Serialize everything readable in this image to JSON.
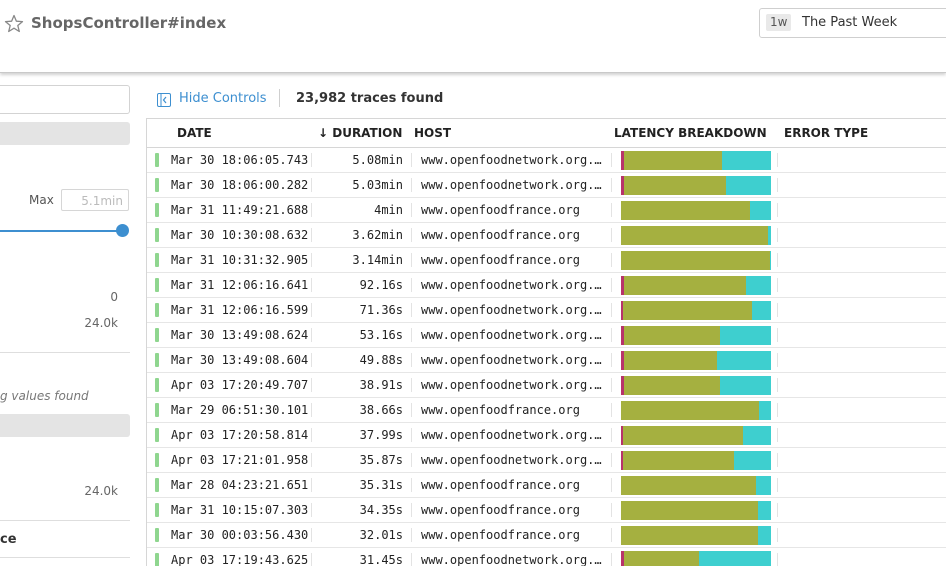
{
  "header": {
    "title": "ShopsController#index",
    "time_badge": "1w",
    "time_label": "The Past Week"
  },
  "left_panel": {
    "max_label": "Max",
    "max_placeholder": "5.1min",
    "count_0": "0",
    "count_1": "24.0k",
    "missing_text": "g values found",
    "count_2": "24.0k",
    "section_label": "ce"
  },
  "controls": {
    "hide_controls_label": "Hide Controls",
    "trace_count": "23,982 traces found"
  },
  "table": {
    "columns": {
      "date": "DATE",
      "duration": "↓ DURATION",
      "host": "HOST",
      "latency": "LATENCY BREAKDOWN",
      "error": "ERROR TYPE"
    },
    "rows": [
      {
        "date": "Mar 30 18:06:05.743",
        "duration": "5.08min",
        "host": "www.openfoodnetwork.org.uk",
        "latency": [
          0.02,
          0.65,
          0.33
        ]
      },
      {
        "date": "Mar 30 18:06:00.282",
        "duration": "5.03min",
        "host": "www.openfoodnetwork.org.uk",
        "latency": [
          0.02,
          0.68,
          0.3
        ]
      },
      {
        "date": "Mar 31 11:49:21.688",
        "duration": "4min",
        "host": "www.openfoodfrance.org",
        "latency": [
          0.0,
          0.86,
          0.14
        ]
      },
      {
        "date": "Mar 30 10:30:08.632",
        "duration": "3.62min",
        "host": "www.openfoodfrance.org",
        "latency": [
          0.0,
          0.98,
          0.02
        ]
      },
      {
        "date": "Mar 31 10:31:32.905",
        "duration": "3.14min",
        "host": "www.openfoodfrance.org",
        "latency": [
          0.0,
          0.99,
          0.01
        ]
      },
      {
        "date": "Mar 31 12:06:16.641",
        "duration": "92.16s",
        "host": "www.openfoodnetwork.org.uk",
        "latency": [
          0.02,
          0.81,
          0.17
        ]
      },
      {
        "date": "Mar 31 12:06:16.599",
        "duration": "71.36s",
        "host": "www.openfoodnetwork.org.uk",
        "latency": [
          0.01,
          0.86,
          0.13
        ]
      },
      {
        "date": "Mar 30 13:49:08.624",
        "duration": "53.16s",
        "host": "www.openfoodnetwork.org.uk",
        "latency": [
          0.02,
          0.64,
          0.34
        ]
      },
      {
        "date": "Mar 30 13:49:08.604",
        "duration": "49.88s",
        "host": "www.openfoodnetwork.org.uk",
        "latency": [
          0.02,
          0.62,
          0.36
        ]
      },
      {
        "date": "Apr 03 17:20:49.707",
        "duration": "38.91s",
        "host": "www.openfoodnetwork.org.uk",
        "latency": [
          0.02,
          0.64,
          0.34
        ]
      },
      {
        "date": "Mar 29 06:51:30.101",
        "duration": "38.66s",
        "host": "www.openfoodfrance.org",
        "latency": [
          0.0,
          0.92,
          0.08
        ]
      },
      {
        "date": "Apr 03 17:20:58.814",
        "duration": "37.99s",
        "host": "www.openfoodnetwork.org.uk",
        "latency": [
          0.01,
          0.8,
          0.19
        ]
      },
      {
        "date": "Apr 03 17:21:01.958",
        "duration": "35.87s",
        "host": "www.openfoodnetwork.org.uk",
        "latency": [
          0.01,
          0.74,
          0.25
        ]
      },
      {
        "date": "Mar 28 04:23:21.651",
        "duration": "35.31s",
        "host": "www.openfoodfrance.org",
        "latency": [
          0.0,
          0.9,
          0.1
        ]
      },
      {
        "date": "Mar 31 10:15:07.303",
        "duration": "34.35s",
        "host": "www.openfoodfrance.org",
        "latency": [
          0.0,
          0.91,
          0.09
        ]
      },
      {
        "date": "Mar 30 00:03:56.430",
        "duration": "32.01s",
        "host": "www.openfoodfrance.org",
        "latency": [
          0.0,
          0.91,
          0.09
        ]
      },
      {
        "date": "Apr 03 17:19:43.625",
        "duration": "31.45s",
        "host": "www.openfoodnetwork.org.uk",
        "latency": [
          0.02,
          0.5,
          0.48
        ]
      }
    ]
  }
}
